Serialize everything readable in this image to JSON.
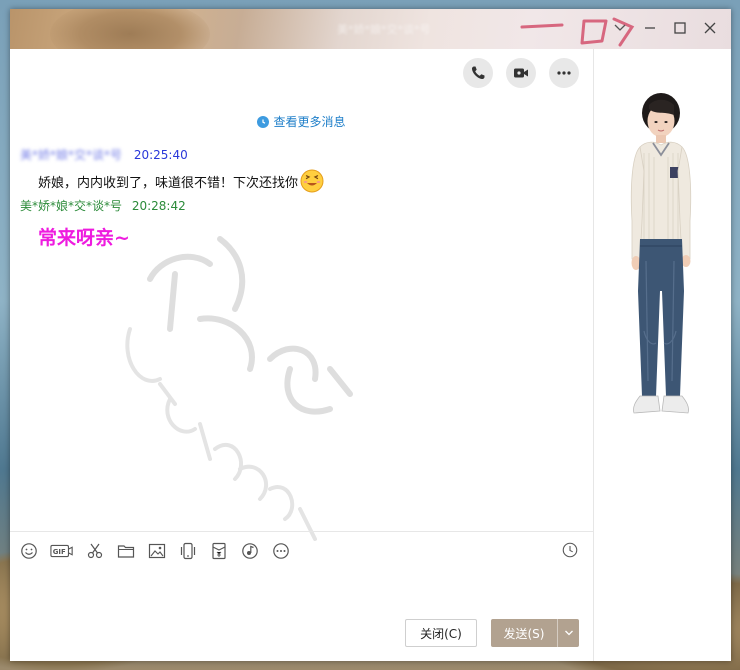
{
  "window": {
    "title_faded": "美*娇*娘*交*谈*号",
    "controls": {
      "menu": "chevron-down-icon",
      "minimize": "minimize-icon",
      "maximize": "maximize-icon",
      "close": "close-icon"
    }
  },
  "header": {
    "call_buttons": [
      {
        "icon": "phone-icon"
      },
      {
        "icon": "video-icon"
      },
      {
        "icon": "more-icon"
      }
    ]
  },
  "chat": {
    "more_messages": "查看更多消息",
    "messages": [
      {
        "sender": "美*娇*娘*交*谈*号",
        "sender_blurred": true,
        "time": "20:25:40",
        "text": "娇娘，内内收到了，味道很不错！下次还找你",
        "emoji": "smile-face-icon"
      },
      {
        "sender": "美*娇*娘*交*谈*号",
        "time": "20:28:42",
        "text": "常来呀亲~"
      }
    ],
    "watermark": "小冰 娇奴 QQ1823193494"
  },
  "toolbar": {
    "tools": [
      "emoji-icon",
      "gif-icon",
      "scissors-icon",
      "folder-icon",
      "image-icon",
      "shake-icon",
      "red-packet-icon",
      "music-icon",
      "more-tools-icon"
    ],
    "gif_label": "GIF",
    "history_icon": "history-clock-icon"
  },
  "footer": {
    "close_label": "关闭(C)",
    "send_label": "发送(S)"
  },
  "colors": {
    "link": "#1f7fc9",
    "time_blue": "#2a38d9",
    "sender_green": "#2c8b3a",
    "highlight_magenta": "#ee1bdf",
    "send_button": "#b2a290"
  }
}
